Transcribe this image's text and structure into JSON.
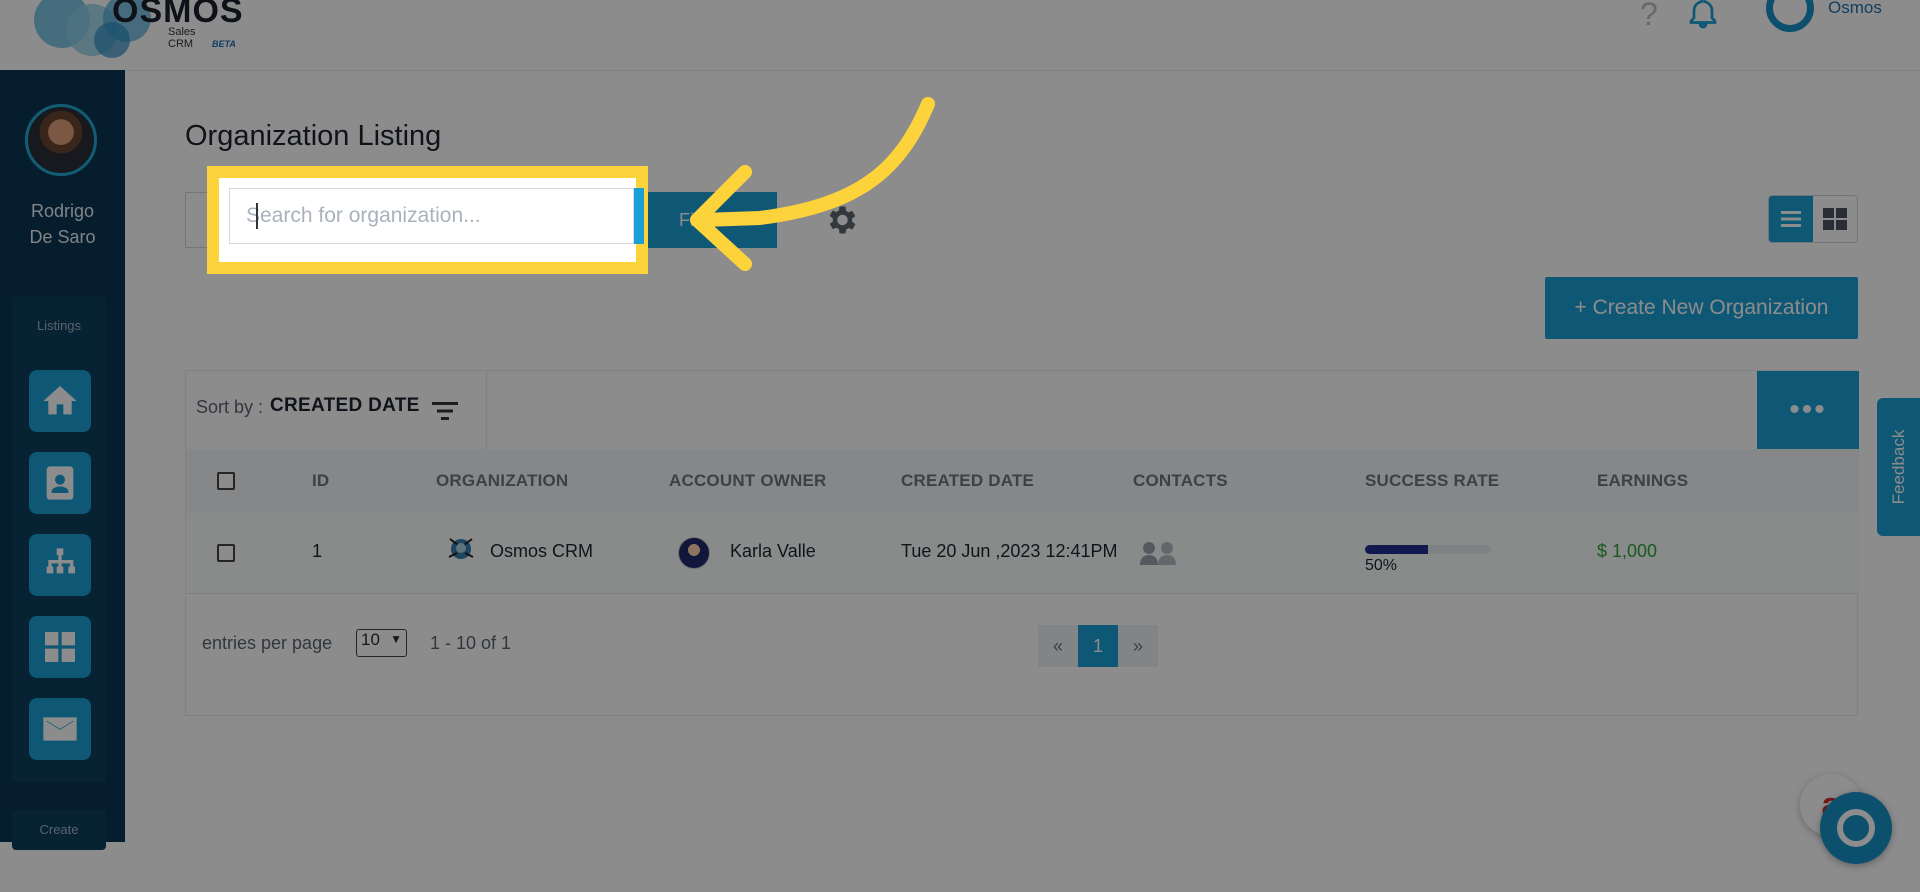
{
  "app": {
    "logo_text": "OSMOS",
    "logo_sub": "Sales CRM",
    "logo_beta": "BETA",
    "user_name": "Osmos"
  },
  "sidebar": {
    "user_name": "Rodrigo De Saro",
    "section_label": "Listings",
    "items": [
      {
        "icon": "home-icon"
      },
      {
        "icon": "contact-card-icon"
      },
      {
        "icon": "org-chart-icon"
      },
      {
        "icon": "grid-icon"
      },
      {
        "icon": "envelope-icon"
      }
    ],
    "create_label": "Create"
  },
  "page": {
    "title": "Organization Listing",
    "search_placeholder": "Search for organization...",
    "filter_label": "Filter",
    "create_button": "+ Create New Organization"
  },
  "sort": {
    "label": "Sort by :",
    "value": "CREATED DATE"
  },
  "table": {
    "headers": [
      "ID",
      "ORGANIZATION",
      "ACCOUNT OWNER",
      "CREATED DATE",
      "CONTACTS",
      "SUCCESS RATE",
      "EARNINGS"
    ],
    "rows": [
      {
        "id": "1",
        "organization": "Osmos CRM",
        "owner": "Karla Valle",
        "created": "Tue 20 Jun ,2023 12:41PM",
        "success_rate": 0.5,
        "success_label": "50%",
        "earnings": "$ 1,000"
      }
    ]
  },
  "footer": {
    "epp_label": "entries per page",
    "epp_value": "10",
    "range": "1 - 10 of 1",
    "pager_prev": "«",
    "pager_page": "1",
    "pager_next": "»"
  },
  "feedback_label": "Feedback",
  "colors": {
    "accent": "#1aa0d6",
    "sidebar": "#0a3550",
    "highlight": "#fdd33b",
    "earnings": "#2da63a"
  }
}
